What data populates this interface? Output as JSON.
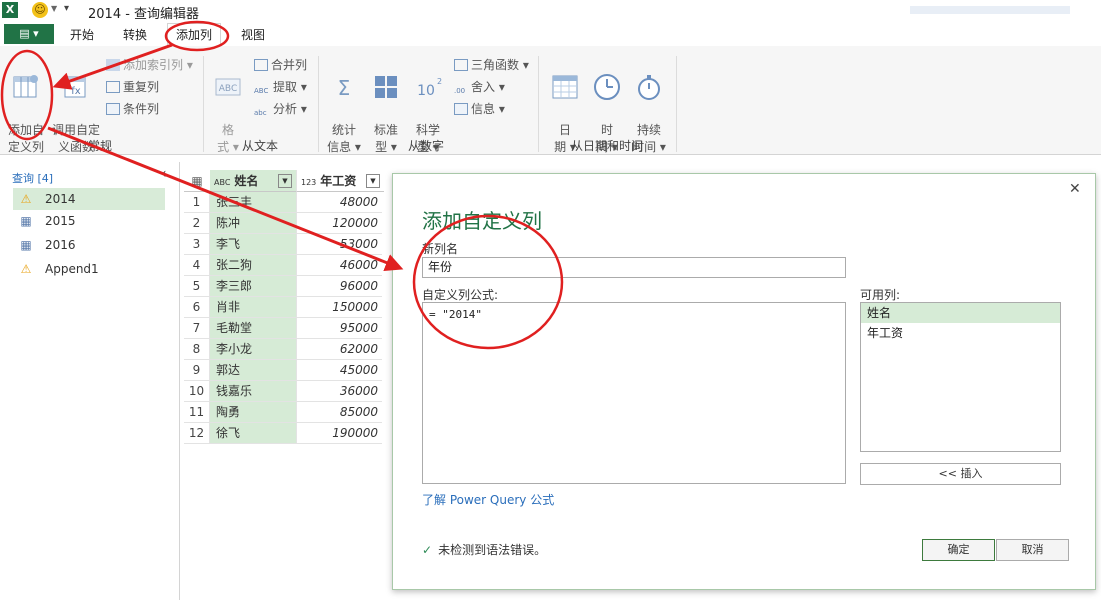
{
  "titlebar": {
    "app_icon": "X",
    "title": "2014 - 查询编辑器"
  },
  "tabs": {
    "file": "▤ ▾",
    "items": [
      "开始",
      "转换",
      "添加列",
      "视图"
    ],
    "active": "添加列"
  },
  "ribbon": {
    "groups": {
      "general": {
        "label": "常规",
        "add_custom": "添加自\n定义列",
        "invoke_custom": "调用自定\n义函数",
        "index_col": "添加索引列",
        "duplicate": "重复列",
        "conditional": "条件列"
      },
      "text": {
        "label": "从文本",
        "format": "格\n式",
        "merge": "合并列",
        "extract": "提取",
        "parse": "分析"
      },
      "number": {
        "label": "从数字",
        "stats": "统计\n信息",
        "standard": "标准\n型",
        "scientific": "科学\n型",
        "trig": "三角函数",
        "round": "舍入",
        "info": "信息"
      },
      "datetime": {
        "label": "从日期和时间",
        "date": "日\n期",
        "time": "时\n间",
        "duration": "持续\n时间"
      }
    }
  },
  "queries": {
    "header": "查询 [4]",
    "items": [
      {
        "name": "2014",
        "icon": "warning-icon",
        "selected": true
      },
      {
        "name": "2015",
        "icon": "table-icon",
        "selected": false
      },
      {
        "name": "2016",
        "icon": "table-icon",
        "selected": false
      },
      {
        "name": "Append1",
        "icon": "warning-icon",
        "selected": false
      }
    ]
  },
  "grid": {
    "columns": [
      {
        "type": "ABC",
        "name": "姓名"
      },
      {
        "type": "123",
        "name": "年工资"
      }
    ],
    "rows": [
      [
        "1",
        "张三丰",
        "48000"
      ],
      [
        "2",
        "陈冲",
        "120000"
      ],
      [
        "3",
        "李飞",
        "53000"
      ],
      [
        "4",
        "张二狗",
        "46000"
      ],
      [
        "5",
        "李三郎",
        "96000"
      ],
      [
        "6",
        "肖非",
        "150000"
      ],
      [
        "7",
        "毛勒堂",
        "95000"
      ],
      [
        "8",
        "李小龙",
        "62000"
      ],
      [
        "9",
        "郭达",
        "45000"
      ],
      [
        "10",
        "钱嘉乐",
        "36000"
      ],
      [
        "11",
        "陶勇",
        "85000"
      ],
      [
        "12",
        "徐飞",
        "190000"
      ]
    ]
  },
  "dialog": {
    "title": "添加自定义列",
    "new_col_label": "新列名",
    "new_col_value": "年份",
    "formula_label": "自定义列公式:",
    "formula_value": "= \"2014\"",
    "available_label": "可用列:",
    "available_items": [
      "姓名",
      "年工资"
    ],
    "insert_button": "<< 插入",
    "learn_link": "了解 Power Query 公式",
    "status": "未检测到语法错误。",
    "ok_button": "确定",
    "cancel_button": "取消"
  },
  "colors": {
    "accent": "#217346",
    "annotation": "#e02020",
    "selection": "#d6ebd6"
  }
}
